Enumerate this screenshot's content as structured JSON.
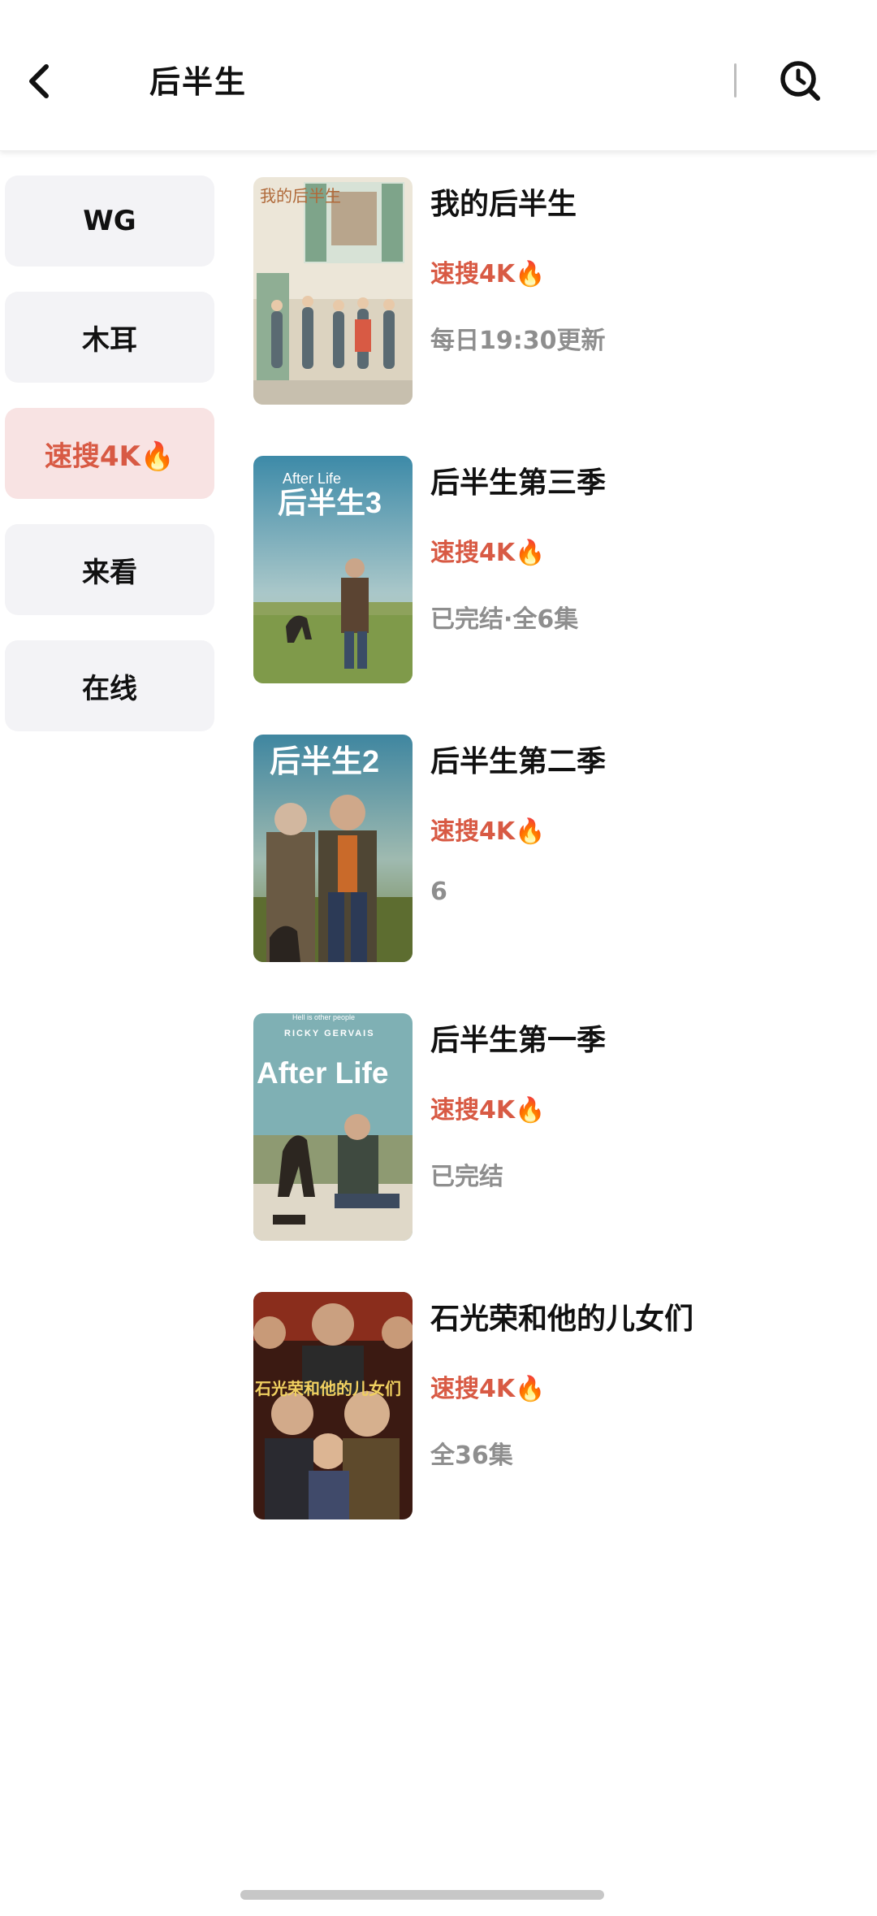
{
  "header": {
    "title": "后半生",
    "back_icon": "chevron-left-icon",
    "search_icon": "search-icon"
  },
  "sidebar": {
    "items": [
      {
        "label": "WG",
        "active": false
      },
      {
        "label": "木耳",
        "active": false
      },
      {
        "label": "速搜4K🔥",
        "active": true
      },
      {
        "label": "来看",
        "active": false
      },
      {
        "label": "在线",
        "active": false
      }
    ]
  },
  "results": [
    {
      "title": "我的后半生",
      "source": "速搜4K🔥",
      "meta": "每日19:30更新",
      "poster_text": "我的后半生"
    },
    {
      "title": "后半生第三季",
      "source": "速搜4K🔥",
      "meta": "已完结·全6集",
      "poster_text": "后半生3",
      "poster_sub": "After Life"
    },
    {
      "title": "后半生第二季",
      "source": "速搜4K🔥",
      "meta": "6",
      "poster_text": "后半生2"
    },
    {
      "title": "后半生第一季",
      "source": "速搜4K🔥",
      "meta": "已完结",
      "poster_text": "After Life",
      "poster_sub": "RICKY GERVAIS",
      "poster_tag": "Hell is other people"
    },
    {
      "title": "石光荣和他的儿女们",
      "source": "速搜4K🔥",
      "meta": "全36集",
      "poster_text": "石光荣和他的儿女们"
    }
  ],
  "colors": {
    "accent": "#d85a44",
    "active_bg": "#f8e3e3",
    "item_bg": "#f3f3f6",
    "meta_gray": "#8e8e8e"
  }
}
